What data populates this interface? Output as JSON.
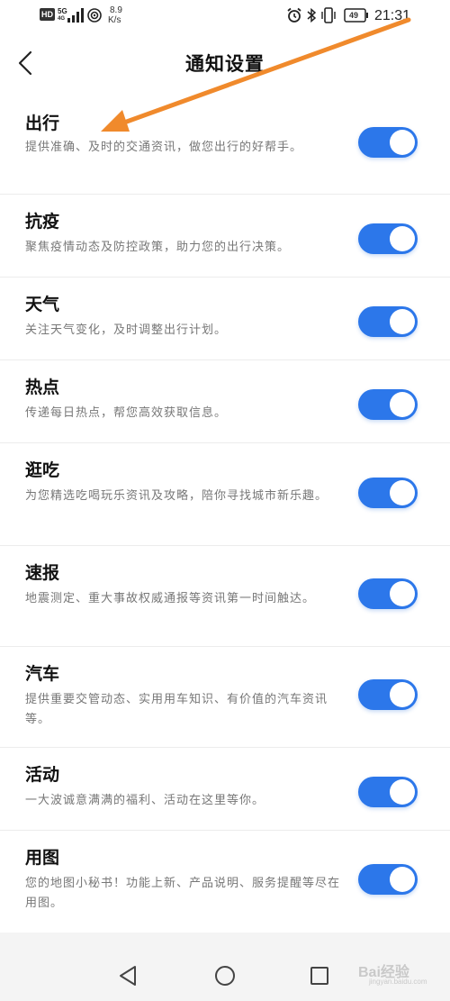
{
  "status_bar": {
    "hd_label": "HD",
    "network_label": "5G",
    "network_sub": "4G",
    "speed_value": "8.9",
    "speed_unit": "K/s",
    "battery": "49",
    "time": "21:31"
  },
  "header": {
    "title": "通知设置"
  },
  "items": [
    {
      "title": "出行",
      "desc": "提供准确、及时的交通资讯，做您出行的好帮手。",
      "enabled": true
    },
    {
      "title": "抗疫",
      "desc": "聚焦疫情动态及防控政策，助力您的出行决策。",
      "enabled": true
    },
    {
      "title": "天气",
      "desc": "关注天气变化，及时调整出行计划。",
      "enabled": true
    },
    {
      "title": "热点",
      "desc": "传递每日热点，帮您高效获取信息。",
      "enabled": true
    },
    {
      "title": "逛吃",
      "desc": "为您精选吃喝玩乐资讯及攻略，陪你寻找城市新乐趣。",
      "enabled": true
    },
    {
      "title": "速报",
      "desc": "地震测定、重大事故权威通报等资讯第一时间触达。",
      "enabled": true
    },
    {
      "title": "汽车",
      "desc": "提供重要交管动态、实用用车知识、有价值的汽车资讯等。",
      "enabled": true
    },
    {
      "title": "活动",
      "desc": "一大波诚意满满的福利、活动在这里等你。",
      "enabled": true
    },
    {
      "title": "用图",
      "desc": "您的地图小秘书！功能上新、产品说明、服务提醒等尽在用图。",
      "enabled": true
    }
  ],
  "watermark": {
    "text": "Bai经验",
    "sub": "jingyan.baidu.com"
  },
  "colors": {
    "accent": "#2c77ea",
    "annotation_arrow": "#f08a2c"
  }
}
